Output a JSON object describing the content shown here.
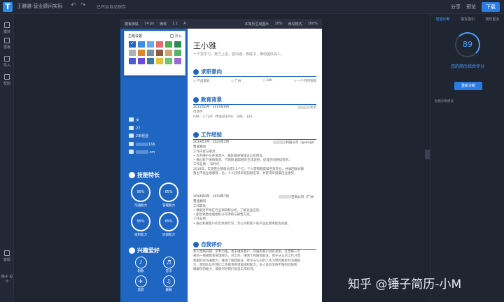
{
  "topbar": {
    "doc_title": "王雅雅-营业顾问实际",
    "autosave": "已开启自动保存",
    "share": "分享",
    "preview": "预览",
    "download": "下载"
  },
  "sidebar": {
    "items": [
      {
        "label": "模块"
      },
      {
        "label": "模板"
      },
      {
        "label": "导入"
      },
      {
        "label": "帮助"
      },
      {
        "label": "客服"
      },
      {
        "label": "稿子 设计"
      }
    ]
  },
  "editor_toolbar": {
    "items": [
      "模板换肤",
      "14 px",
      "微软",
      "1.1",
      "A"
    ],
    "right_items": [
      "本简历生成图片",
      "20%",
      "移动模式",
      "100%"
    ]
  },
  "color_panel": {
    "title": "主题设置",
    "default_label": "默认",
    "colors": [
      "#1f66c3",
      "#3a8ee6",
      "#6aa8e8",
      "#e66a6a",
      "#4caf50",
      "#2e8b57",
      "#b0b0b0",
      "#e0862a",
      "#7b8fa3",
      "#8a5a3c",
      "#d2a36a",
      "#56b26b",
      "#4a5ad8",
      "#6b4ad8",
      "#3c7a9a",
      "#e0c33a",
      "#6ac56b",
      "#9a6ad8"
    ],
    "selected_index": 0
  },
  "resume": {
    "name": "王小雅",
    "motto": "一个爱学习，努力上进，善沟通，靠能书，推动团队的人。",
    "contacts": [
      "女",
      "27",
      "2年经验",
      "166",
      ".cm"
    ],
    "skills_title": "技能特长",
    "skills": [
      {
        "pct": "95%",
        "label": "沟通能力"
      },
      {
        "pct": "65%",
        "label": "管理能力"
      },
      {
        "pct": "95%",
        "label": "组织能力"
      },
      {
        "pct": "65%",
        "label": "协调能力"
      }
    ],
    "hobbies_title": "兴趣爱好",
    "hobbies": [
      {
        "icon": "♪",
        "label": "唱歌"
      },
      {
        "icon": "♬",
        "label": "音乐"
      },
      {
        "icon": "✈",
        "label": "旅游"
      },
      {
        "icon": "♫",
        "label": "跳舞"
      },
      {
        "icon": "⚽",
        "label": "运动"
      },
      {
        "icon": "☼",
        "label": "舞蹈"
      }
    ],
    "intent_title": "求职意向",
    "intent": [
      "产品策划",
      "广州",
      "20K",
      "一个月内到岗"
    ],
    "edu_title": "教育背景",
    "edu_period": "2015年6月 - 2019年6月",
    "edu_school": "大学",
    "edu_major": "市场学",
    "edu_gpa": "GPA：3.72/4（专业前10%） GRE：324",
    "work_title": "工作经验",
    "job1_period": "2019年7月 - 2020年2月",
    "job1_company": "科技公司（guangz）",
    "job1_role": "营业顾问",
    "job1_lines": [
      "工作内容与职责：",
      "• 负责维护与开发客户，做好跟进管理记以及回访。",
      "• 通过客户采购情况、下期目 跟踪管的方法途径，促成合同继续签单。",
      "工作业绩：   有时代",
      "2019年，实现营业销售达成1.5个亿，个人营销额度排名第专业，并收回款总额",
      "量出不低业绩额等，化，个人获得年度前额名等，并获得年度最佳业绩奖。"
    ],
    "job2_period": "2019年6月 - 2019年7月",
    "job2_company": "咨询公司（广州）",
    "job2_role": "营业顾问",
    "job2_lines": [
      "工作职责：",
      "• 根据对市场在行业调研和分析，了解竞品信息。",
      "• 配合销售经理组织公司项目与销售方案。",
      "工作业绩：",
      "• 通过和顾客户的实体进行沟，为公司和客户的产品业绩率提高贡献。"
    ],
    "eval_title": "自我评价",
    "eval_lines": [
      "本人性格开朗，亲和力强，善于维系客户，开展和客户良好关系。在营销三年",
      "来的一线销售和管理经历，对工作、维测了和解得能业，善于从认识工作习惯",
      "和跟好的沟通能力，维测了解得能业，善于与认识的工作习惯和跟好的沟通能",
      "力，使团队队在我们工作职责希望能组织能力。本人具有坚持不懈的忍耐和",
      "磁解创的能力，能够对对我们优良工作状况。"
    ]
  },
  "right_panel": {
    "tabs": [
      "智能诊断",
      "填写指引",
      "简历更多"
    ],
    "score": "89",
    "score_label": "您的简历综合评分",
    "rediagnose": "重新诊断",
    "diag_hint": "智能诊断建议"
  },
  "watermark": "知乎 @锤子简历-小M"
}
